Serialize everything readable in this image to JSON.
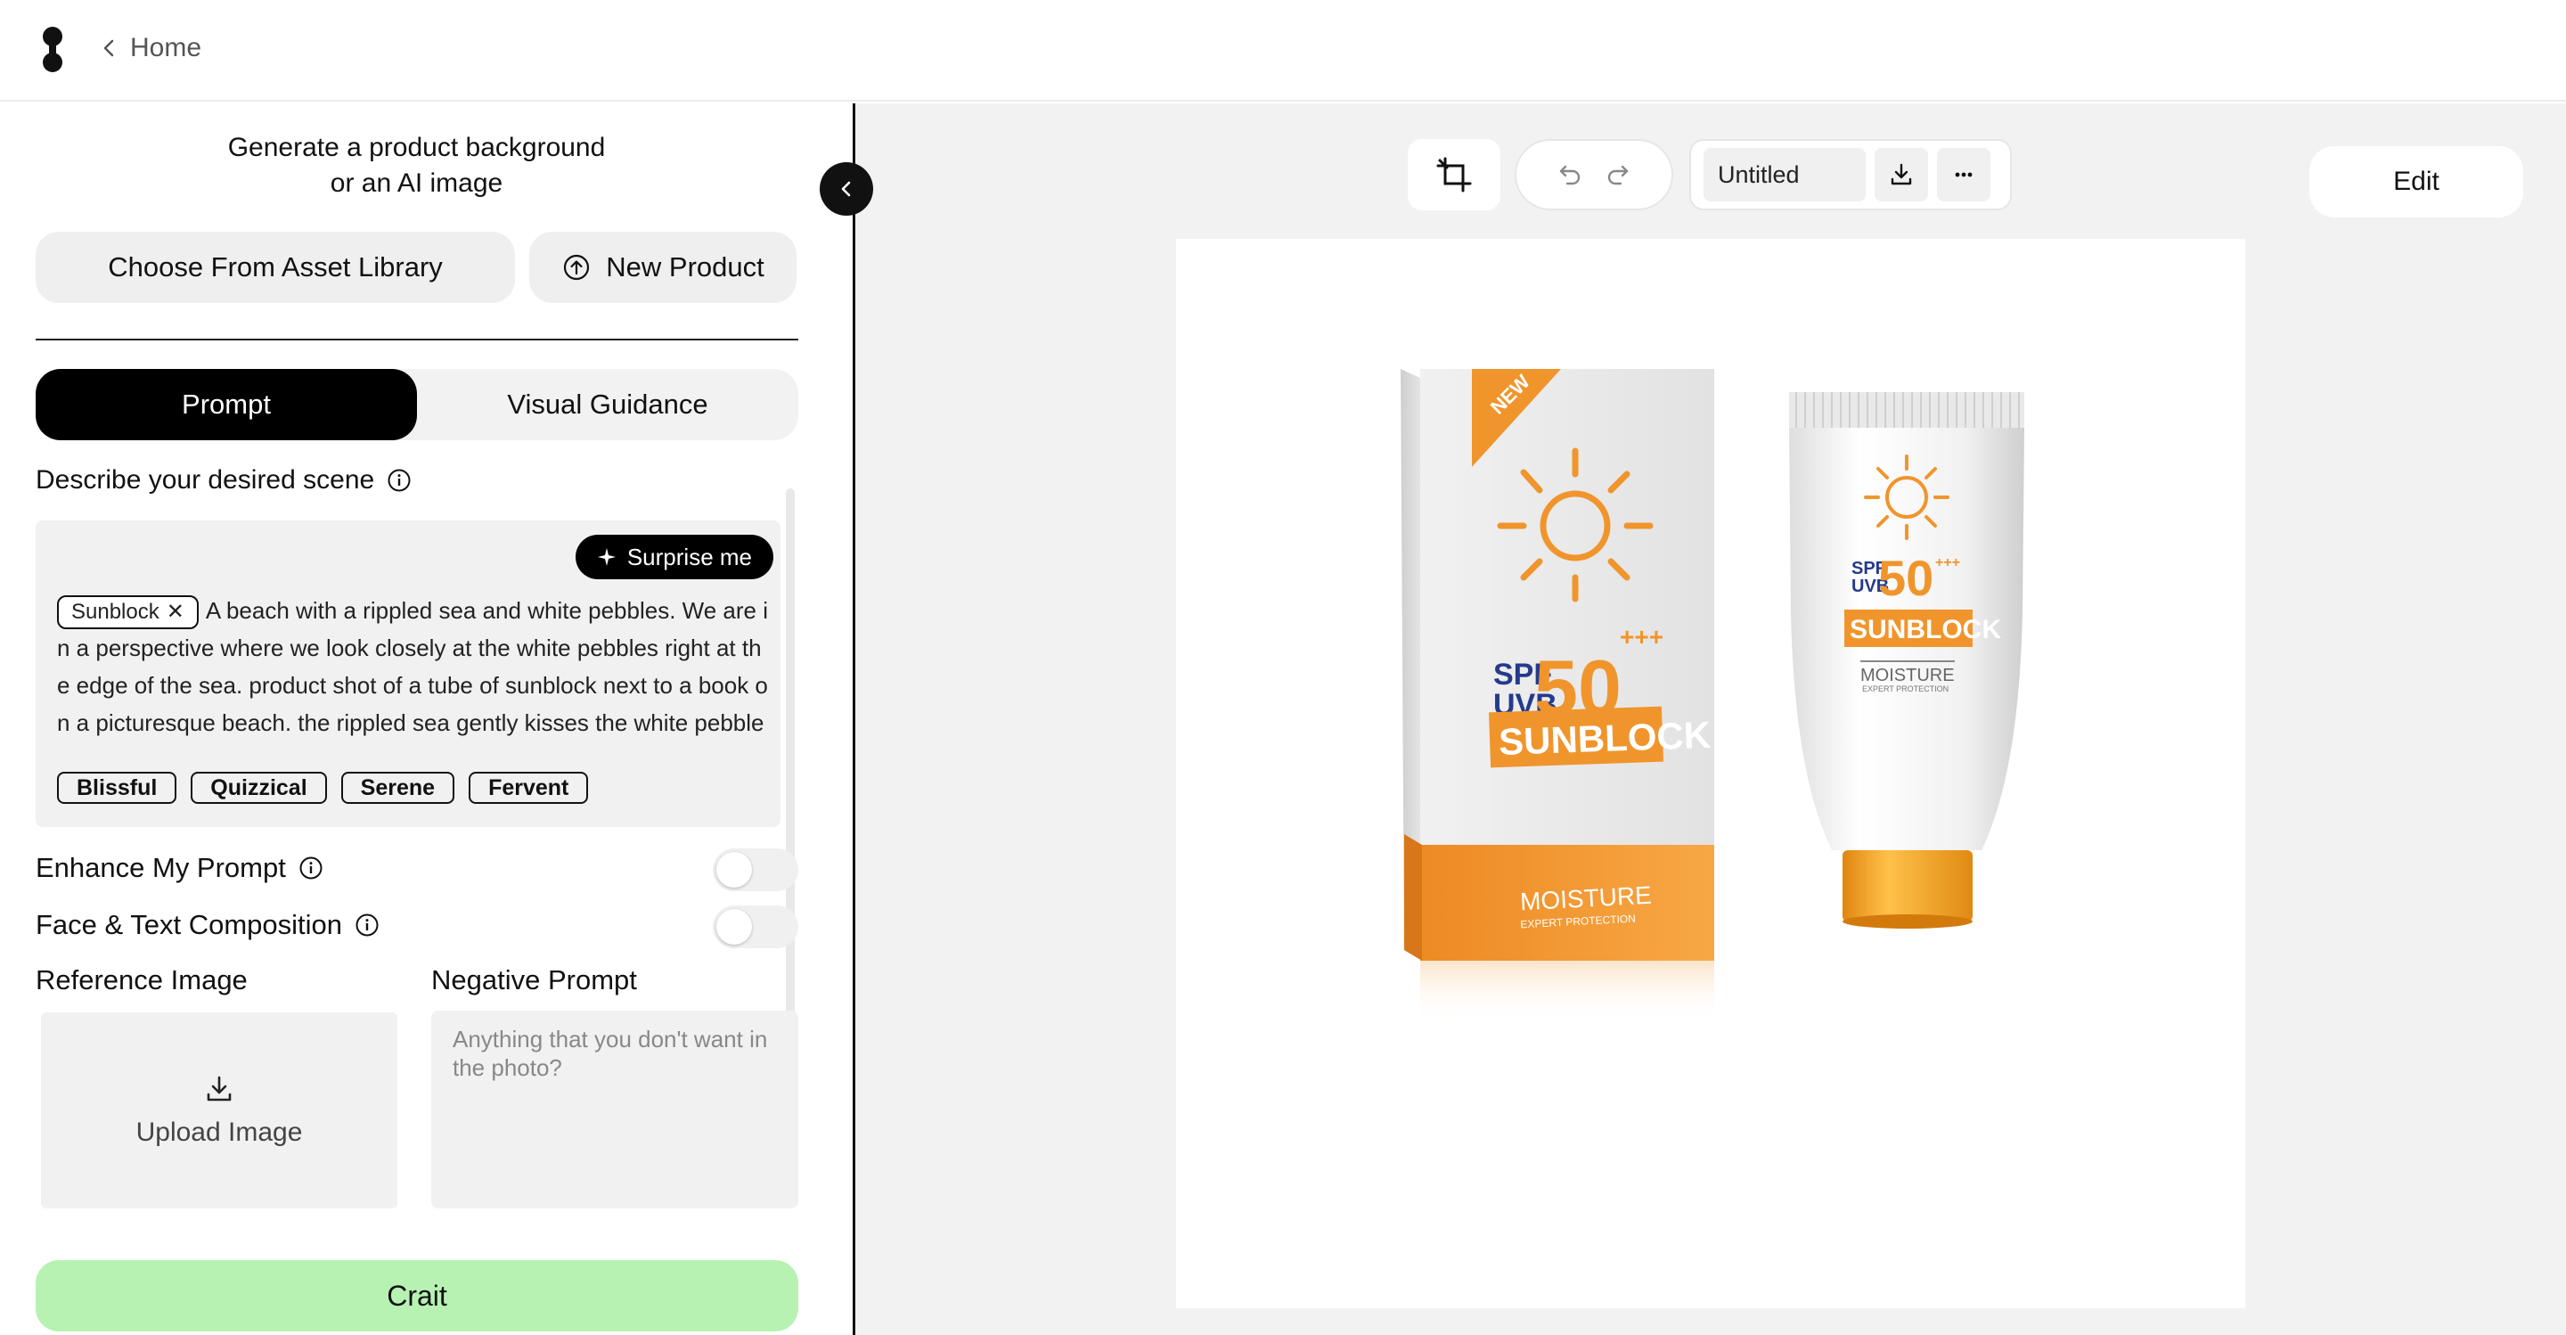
{
  "header": {
    "back_label": "Home",
    "icons": [
      "logo-icon",
      "chevron-left-icon"
    ]
  },
  "left_panel": {
    "title_line1": "Generate a product background",
    "title_line2": "or an AI image",
    "asset_button": "Choose From Asset Library",
    "new_product_button": "New Product",
    "tabs": [
      {
        "label": "Prompt",
        "active": true
      },
      {
        "label": "Visual Guidance",
        "active": false
      }
    ],
    "describe_label": "Describe your desired scene",
    "surprise_label": "Surprise me",
    "product_tag": "Sunblock",
    "prompt_text": "A beach with a rippled sea and white pebbles. We are in a perspective where we look closely at the white pebbles right at the edge of the sea.  product shot of a tube of sunblock next to a book on a picturesque beach. the rippled sea gently kisses the white pebbles at the water's edge. the warm, golden sunlight dances on the",
    "moods": [
      "Blissful",
      "Quizzical",
      "Serene",
      "Fervent"
    ],
    "enhance_label": "Enhance My Prompt",
    "enhance_on": false,
    "face_text_label": "Face & Text Composition",
    "face_text_on": false,
    "reference_label": "Reference Image",
    "upload_label": "Upload Image",
    "negative_label": "Negative Prompt",
    "negative_placeholder": "Anything that you don't want in the photo?",
    "negative_value": "",
    "submit_label": "Crait"
  },
  "toolbar": {
    "document_title": "Untitled",
    "edit_label": "Edit",
    "icons": [
      "crop-icon",
      "undo-icon",
      "redo-icon",
      "download-icon",
      "more-icon"
    ]
  },
  "product": {
    "box_badge": "NEW",
    "spf_label": "SPF",
    "uvb_label": "UVB",
    "spf_value": "50",
    "plus_marks": "+++",
    "name": "SUNBLOCK",
    "sub_name": "MOISTURE",
    "sub_tagline": "EXPERT PROTECTION",
    "accent_color": "#f0952c",
    "navy_color": "#243a8c"
  },
  "colors": {
    "submit_bg": "#b7f2b3",
    "active_tab_bg": "#000000",
    "canvas_bg": "#f2f2f2"
  }
}
